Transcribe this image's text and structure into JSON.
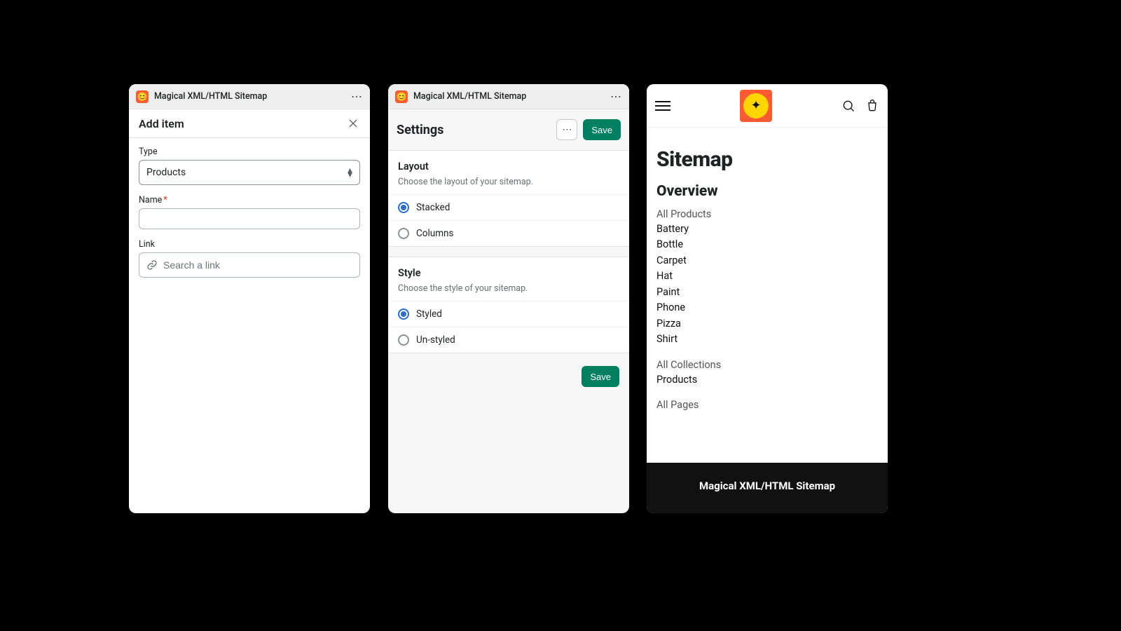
{
  "app_name": "Magical XML/HTML Sitemap",
  "panel1": {
    "heading": "Add item",
    "type_label": "Type",
    "type_value": "Products",
    "name_label": "Name",
    "link_label": "Link",
    "link_placeholder": "Search a link"
  },
  "panel2": {
    "heading": "Settings",
    "save_label": "Save",
    "layout": {
      "title": "Layout",
      "desc": "Choose the layout of your sitemap.",
      "opt_stacked": "Stacked",
      "opt_columns": "Columns",
      "selected": "stacked"
    },
    "style": {
      "title": "Style",
      "desc": "Choose the style of your sitemap.",
      "opt_styled": "Styled",
      "opt_unstyled": "Un-styled",
      "selected": "styled"
    }
  },
  "panel3": {
    "title": "Sitemap",
    "overview": "Overview",
    "products_head": "All Products",
    "products": [
      "Battery",
      "Bottle",
      "Carpet",
      "Hat",
      "Paint",
      "Phone",
      "Pizza",
      "Shirt"
    ],
    "collections_head": "All Collections",
    "collections": [
      "Products"
    ],
    "pages_head": "All Pages",
    "footer": "Magical XML/HTML Sitemap"
  }
}
